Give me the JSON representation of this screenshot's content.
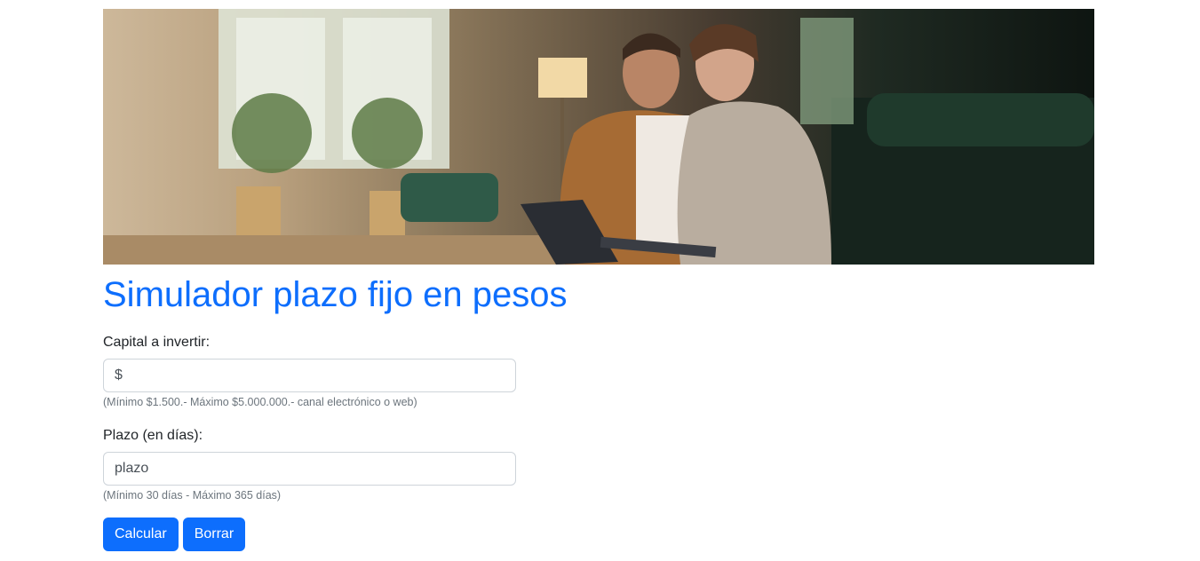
{
  "hero": {
    "image_description": "couple-using-laptop-photo"
  },
  "page": {
    "title": "Simulador plazo fijo en pesos"
  },
  "form": {
    "capital": {
      "label": "Capital a invertir:",
      "placeholder": "$",
      "help": "(Mínimo $1.500.- Máximo $5.000.000.- canal electrónico o web)"
    },
    "plazo": {
      "label": "Plazo (en días):",
      "placeholder": "plazo",
      "help": "(Mínimo 30 días - Máximo 365 días)"
    },
    "buttons": {
      "calcular": "Calcular",
      "borrar": "Borrar"
    }
  },
  "colors": {
    "primary": "#0d6efd",
    "muted": "#6c757d"
  }
}
